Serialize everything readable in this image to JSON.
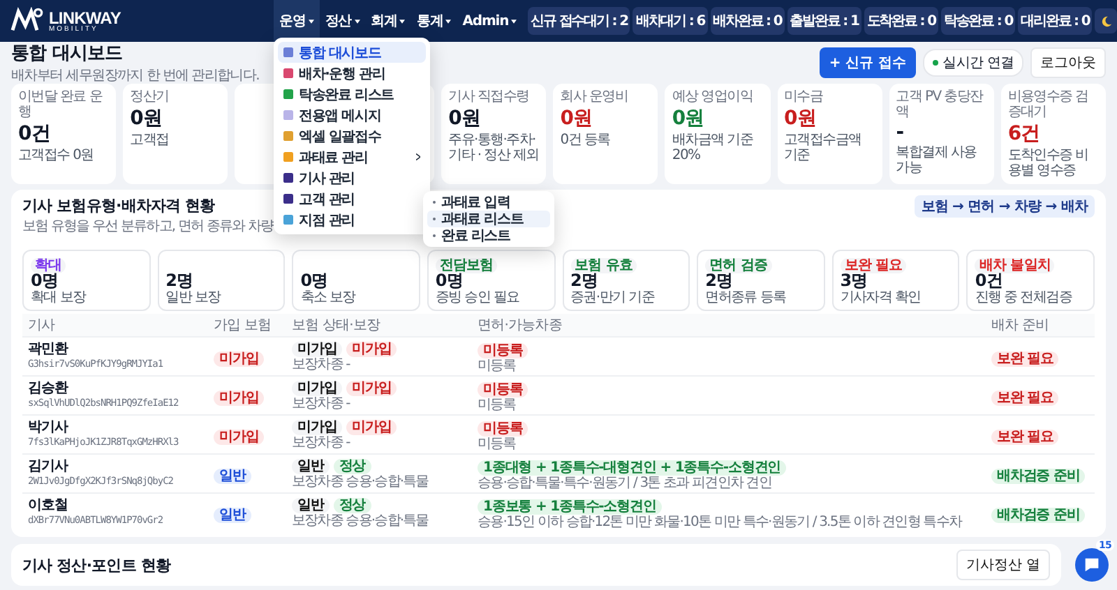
{
  "header": {
    "logo": {
      "name": "LINKWAY",
      "tagline": "MOBILITY"
    },
    "nav": [
      {
        "label": "운영",
        "selected": true
      },
      {
        "label": "정산",
        "selected": false
      },
      {
        "label": "회계",
        "selected": false
      },
      {
        "label": "통계",
        "selected": false
      },
      {
        "label": "Admin",
        "selected": false
      }
    ],
    "status_chips": [
      "신규 접수대기 : 2",
      "배차대기 : 6",
      "배차완료 : 0",
      "출발완료 : 1",
      "도착완료 : 0",
      "탁송완료 : 0",
      "대리완료 : 0"
    ]
  },
  "menu": {
    "items": [
      {
        "label": "통합 대시보드",
        "selected": true
      },
      {
        "label": "배차·운행 관리",
        "selected": false
      },
      {
        "label": "탁송완료 리스트",
        "selected": false
      },
      {
        "label": "전용앱 메시지",
        "selected": false
      },
      {
        "label": "엑셀 일괄접수",
        "selected": false
      },
      {
        "label": "과태료 관리",
        "selected": false,
        "expanded": true,
        "submenu": [
          {
            "label": "과태료 입력",
            "selected": false
          },
          {
            "label": "과태료 리스트",
            "selected": true
          },
          {
            "label": "완료 리스트",
            "selected": false
          }
        ]
      },
      {
        "label": "기사 관리",
        "selected": false
      },
      {
        "label": "고객 관리",
        "selected": false
      },
      {
        "label": "지점 관리",
        "selected": false
      }
    ]
  },
  "page": {
    "title": "통합 대시보드",
    "subtitle": "배차부터 세무원장까지 한 번에 관리합니다.",
    "new_button": "+ 신규 접수",
    "live_status": "실시간 연결",
    "logout": "로그아웃"
  },
  "summary_cards": [
    {
      "label": "이번달 완료 운행",
      "value": "0건",
      "note": "고객접수 0원",
      "color": "#111827"
    },
    {
      "label": "정산기",
      "value": "0원",
      "note": "고객접",
      "color": "#111827"
    },
    {
      "label": "기사 직접수령",
      "value": "0원",
      "note": "주유·통행·주차·기타 · 정산 제외",
      "color": "#111827"
    },
    {
      "label": "회사 운영비",
      "value": "0원",
      "note": "0건 등록",
      "color": "#c81e1e"
    },
    {
      "label": "예상 영업이익",
      "value": "0원",
      "note": "배차금액 기준 20%",
      "color": "#15803d"
    },
    {
      "label": "미수금",
      "value": "0원",
      "note": "고객접수금액 기준",
      "color": "#c81e1e"
    },
    {
      "label": "고객 PV 충당잔액",
      "value": "-",
      "note": "복합결제 사용 가능",
      "color": "#111827"
    },
    {
      "label": "비용영수증 검증대기",
      "value": "6건",
      "note": "도착인수증 비용별 영수증",
      "color": "#c81e1e"
    }
  ],
  "insurance": {
    "title": "기사 보험유형·배차자격 현황",
    "subtitle": "보험 유형을 우선 분류하고, 면허 종류와 차량",
    "flow": "보험 → 면허 → 차량 → 배차",
    "cards": [
      {
        "badge": "확대",
        "color": "#7c3aed",
        "value": "0명",
        "note": "확대 보장"
      },
      {
        "value": "2명",
        "note": "일반 보장"
      },
      {
        "value": "0명",
        "note": "축소 보장"
      },
      {
        "badge": "전담보험",
        "color": "#15803d",
        "value": "0명",
        "note": "증빙 승인 필요"
      },
      {
        "badge": "보험 유효",
        "color": "#15803d",
        "value": "2명",
        "note": "증권·만기 기준"
      },
      {
        "badge": "면허 검증",
        "color": "#15803d",
        "value": "2명",
        "note": "면허종류 등록"
      },
      {
        "badge": "보완 필요",
        "color": "#dc2626",
        "value": "3명",
        "note": "기사자격 확인"
      },
      {
        "badge": "배차 불일치",
        "color": "#dc2626",
        "value": "0건",
        "note": "진행 중 전체검증"
      }
    ],
    "table": {
      "columns": [
        "기사",
        "가입 보험",
        "보험 상태·보장",
        "면허·가능차종",
        "배차 준비"
      ],
      "rows": [
        {
          "name": "곽민환",
          "uid": "G3hsir7vS0KuPfKJY9gRMJYIa1",
          "plan": "미가입",
          "plan_ok": false,
          "status": [
            "미가입",
            "미가입"
          ],
          "status_ok": false,
          "coverage": "보장차종 -",
          "licenses": "미등록",
          "license_ok": false,
          "vehicles": "미등록",
          "readiness": "보완 필요",
          "ready": false
        },
        {
          "name": "김승환",
          "uid": "sxSqlVhUDlQ2bsNRH1PQ9ZfeIaE12",
          "plan": "미가입",
          "plan_ok": false,
          "status": [
            "미가입",
            "미가입"
          ],
          "status_ok": false,
          "coverage": "보장차종 -",
          "licenses": "미등록",
          "license_ok": false,
          "vehicles": "미등록",
          "readiness": "보완 필요",
          "ready": false
        },
        {
          "name": "박기사",
          "uid": "7fs3lKaPHjoJK1ZJR8TqxGMzHRXl3",
          "plan": "미가입",
          "plan_ok": false,
          "status": [
            "미가입",
            "미가입"
          ],
          "status_ok": false,
          "coverage": "보장차종 -",
          "licenses": "미등록",
          "license_ok": false,
          "vehicles": "미등록",
          "readiness": "보완 필요",
          "ready": false
        },
        {
          "name": "김기사",
          "uid": "2W1Jv0JgDfgX2KJf3rSNq8jQbyC2",
          "plan": "일반",
          "plan_ok": true,
          "status": [
            "일반",
            "정상"
          ],
          "status_ok": true,
          "coverage": "보장차종 승용·승합·특물",
          "licenses": "1종대형 + 1종특수-대형견인 + 1종특수-소형견인",
          "license_ok": true,
          "vehicles": "승용·승합·특물·특수·원동기 / 3톤 초과 피견인차 견인",
          "readiness": "배차검증 준비",
          "ready": true
        },
        {
          "name": "이호철",
          "uid": "dXBr77VNu0ABTLW8YW1P70vGr2",
          "plan": "일반",
          "plan_ok": true,
          "status": [
            "일반",
            "정상"
          ],
          "status_ok": true,
          "coverage": "보장차종 승용·승합·특물",
          "licenses": "1종보통 + 1종특수-소형견인",
          "license_ok": true,
          "vehicles": "승용·15인 이하 승합·12톤 미만 화물·10톤 미만 특수·원동기 / 3.5톤 이하 견인형 특수차",
          "readiness": "배차검증 준비",
          "ready": true
        }
      ]
    }
  },
  "settlement": {
    "title": "기사 정산·포인트 현황",
    "open_button": "기사정산 열"
  },
  "chat": {
    "badge": "15"
  }
}
